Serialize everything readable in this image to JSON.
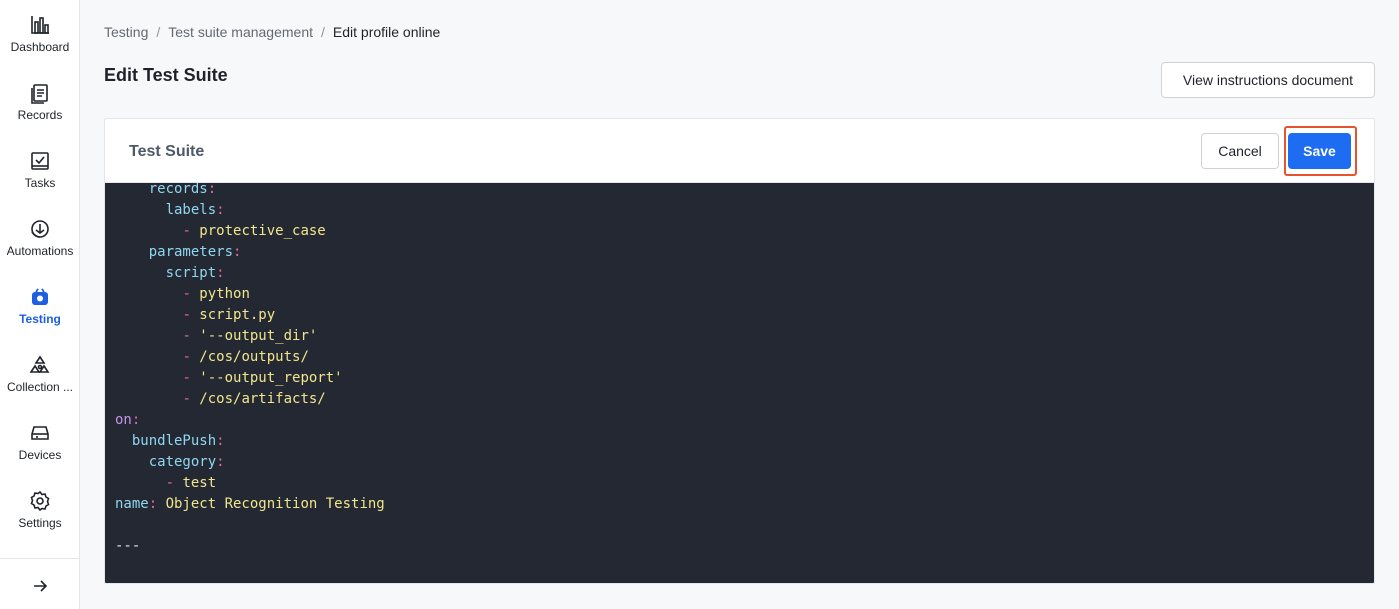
{
  "sidebar": {
    "items": [
      {
        "label": "Dashboard",
        "icon": "bar-chart-icon",
        "active": false
      },
      {
        "label": "Records",
        "icon": "records-icon",
        "active": false
      },
      {
        "label": "Tasks",
        "icon": "tasks-icon",
        "active": false
      },
      {
        "label": "Automations",
        "icon": "automations-icon",
        "active": false
      },
      {
        "label": "Testing",
        "icon": "testing-icon",
        "active": true
      },
      {
        "label": "Collection ...",
        "icon": "collection-icon",
        "active": false
      },
      {
        "label": "Devices",
        "icon": "devices-icon",
        "active": false
      },
      {
        "label": "Settings",
        "icon": "gear-icon",
        "active": false
      }
    ],
    "collapse_icon": "arrow-right-icon"
  },
  "breadcrumb": {
    "items": [
      "Testing",
      "Test suite management",
      "Edit profile online"
    ],
    "separator": "/"
  },
  "page": {
    "title": "Edit Test Suite",
    "docs_button": "View instructions document"
  },
  "card": {
    "title": "Test Suite",
    "cancel_label": "Cancel",
    "save_label": "Save"
  },
  "colors": {
    "accent": "#1d6cf2",
    "highlight_border": "#e5532f",
    "editor_bg": "#242833"
  },
  "code": {
    "lines": [
      [
        {
          "t": "    "
        },
        {
          "k": "records"
        },
        {
          "p": ":"
        }
      ],
      [
        {
          "t": "      "
        },
        {
          "k": "labels"
        },
        {
          "p": ":"
        }
      ],
      [
        {
          "t": "        "
        },
        {
          "d": "- "
        },
        {
          "s": "protective_case"
        }
      ],
      [
        {
          "t": "    "
        },
        {
          "k": "parameters"
        },
        {
          "p": ":"
        }
      ],
      [
        {
          "t": "      "
        },
        {
          "k": "script"
        },
        {
          "p": ":"
        }
      ],
      [
        {
          "t": "        "
        },
        {
          "d": "- "
        },
        {
          "s": "python"
        }
      ],
      [
        {
          "t": "        "
        },
        {
          "d": "- "
        },
        {
          "s": "script.py"
        }
      ],
      [
        {
          "t": "        "
        },
        {
          "d": "- "
        },
        {
          "s": "'--output_dir'"
        }
      ],
      [
        {
          "t": "        "
        },
        {
          "d": "- "
        },
        {
          "s": "/cos/outputs/"
        }
      ],
      [
        {
          "t": "        "
        },
        {
          "d": "- "
        },
        {
          "s": "'--output_report'"
        }
      ],
      [
        {
          "t": "        "
        },
        {
          "d": "- "
        },
        {
          "s": "/cos/artifacts/"
        }
      ],
      [
        {
          "w": "on"
        },
        {
          "p": ":"
        }
      ],
      [
        {
          "t": "  "
        },
        {
          "k": "bundlePush"
        },
        {
          "p": ":"
        }
      ],
      [
        {
          "t": "    "
        },
        {
          "k": "category"
        },
        {
          "p": ":"
        }
      ],
      [
        {
          "t": "      "
        },
        {
          "d": "- "
        },
        {
          "s": "test"
        }
      ],
      [
        {
          "k": "name"
        },
        {
          "p": ": "
        },
        {
          "s": "Object Recognition Testing"
        }
      ],
      [
        {
          "t": ""
        }
      ],
      [
        {
          "t": "---"
        }
      ],
      [
        {
          "t": ""
        }
      ]
    ]
  }
}
